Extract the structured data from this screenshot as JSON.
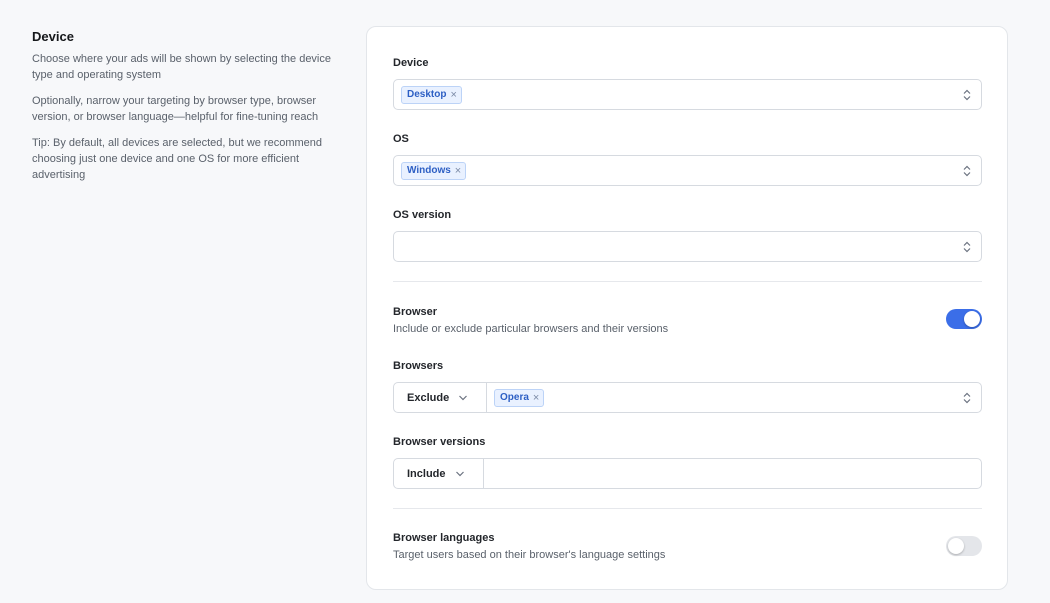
{
  "intro": {
    "title": "Device",
    "p1": "Choose where your ads will be shown by selecting the device type and operating system",
    "p2": "Optionally, narrow your targeting by browser type, browser version, or browser language—helpful for fine-tuning reach",
    "p3": "Tip: By default, all devices are selected, but we recommend choosing just one device and one OS for more efficient advertising"
  },
  "device": {
    "label": "Device",
    "tags": [
      "Desktop"
    ]
  },
  "os": {
    "label": "OS",
    "tags": [
      "Windows"
    ]
  },
  "os_version": {
    "label": "OS version"
  },
  "browser": {
    "label": "Browser",
    "description": "Include or exclude particular browsers and their versions",
    "enabled": true
  },
  "browsers": {
    "label": "Browsers",
    "mode": "Exclude",
    "tags": [
      "Opera"
    ]
  },
  "browser_versions": {
    "label": "Browser versions",
    "mode": "Include"
  },
  "browser_languages": {
    "label": "Browser languages",
    "description": "Target users based on their browser's language settings",
    "enabled": false
  },
  "icons": {
    "remove": "close-icon",
    "select": "chevron-up-down-icon",
    "dropdown": "chevron-down-icon"
  },
  "colors": {
    "accent": "#3b6ee8",
    "tag_bg": "#e9f1ff",
    "tag_text": "#2d5fc4"
  }
}
